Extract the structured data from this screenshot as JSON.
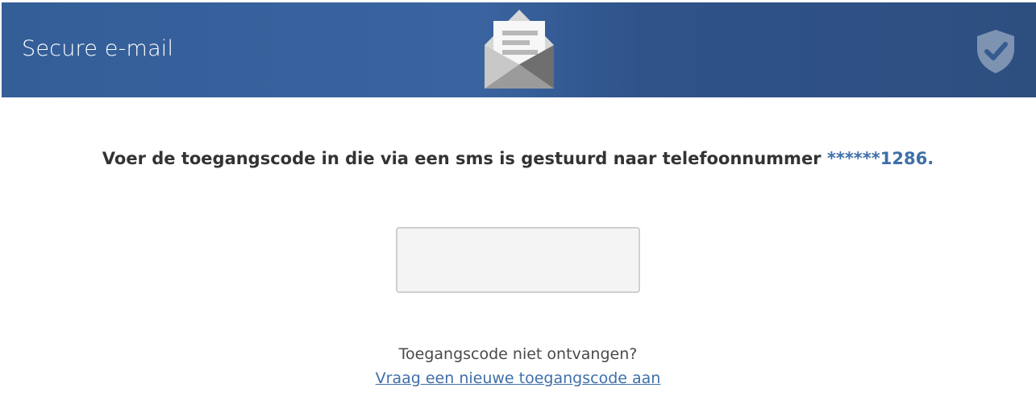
{
  "header": {
    "title": "Secure e-mail",
    "icons": {
      "center": "envelope-letter-icon",
      "right": "shield-check-icon"
    },
    "colors": {
      "header_blue": "#345e98",
      "header_dark_blue": "#2d4f80"
    }
  },
  "main": {
    "instruction_prefix": "Voer de toegangscode in die via een sms is gestuurd naar telefoonnummer",
    "phone_masked": "******1286",
    "instruction_suffix": ".",
    "code_input": {
      "value": "",
      "placeholder": ""
    },
    "not_received_text": "Toegangscode niet ontvangen?",
    "resend_link_text": "Vraag een nieuwe toegangscode aan"
  },
  "colors": {
    "accent": "#3f6fa8",
    "text": "#333333",
    "input_background": "#f4f4f4",
    "input_border": "#cfcfcf"
  }
}
